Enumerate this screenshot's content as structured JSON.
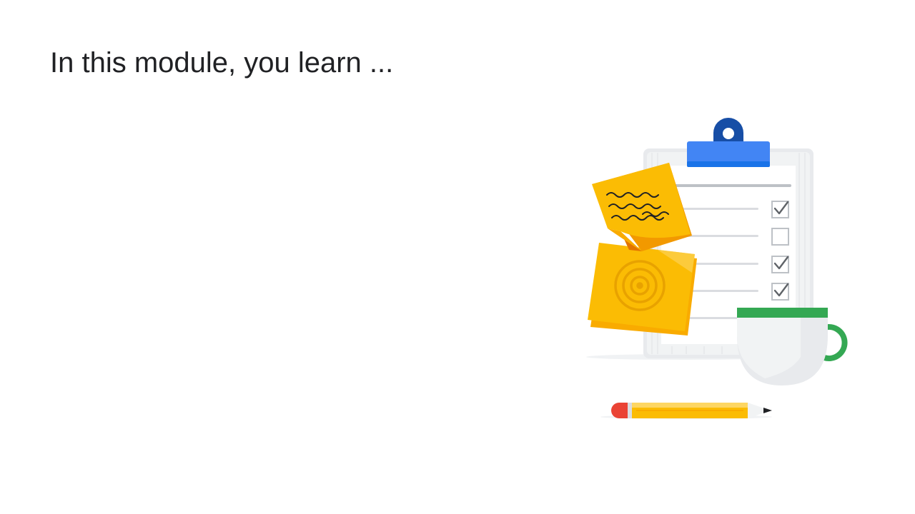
{
  "slide": {
    "title": "In this module, you learn ..."
  },
  "illustration": {
    "items": [
      "clipboard-icon",
      "sticky-note-icon",
      "target-icon",
      "checkbox-icon",
      "coffee-cup-icon",
      "pencil-icon"
    ],
    "checklist": [
      true,
      false,
      true,
      true
    ],
    "colors": {
      "clip_blue": "#4285f4",
      "clip_dark_blue": "#174ea6",
      "note_yellow": "#fbbc04",
      "note_orange": "#f29900",
      "cup_green": "#34a853",
      "pencil_red": "#ea4335",
      "clipboard_gray": "#f1f3f4"
    }
  }
}
